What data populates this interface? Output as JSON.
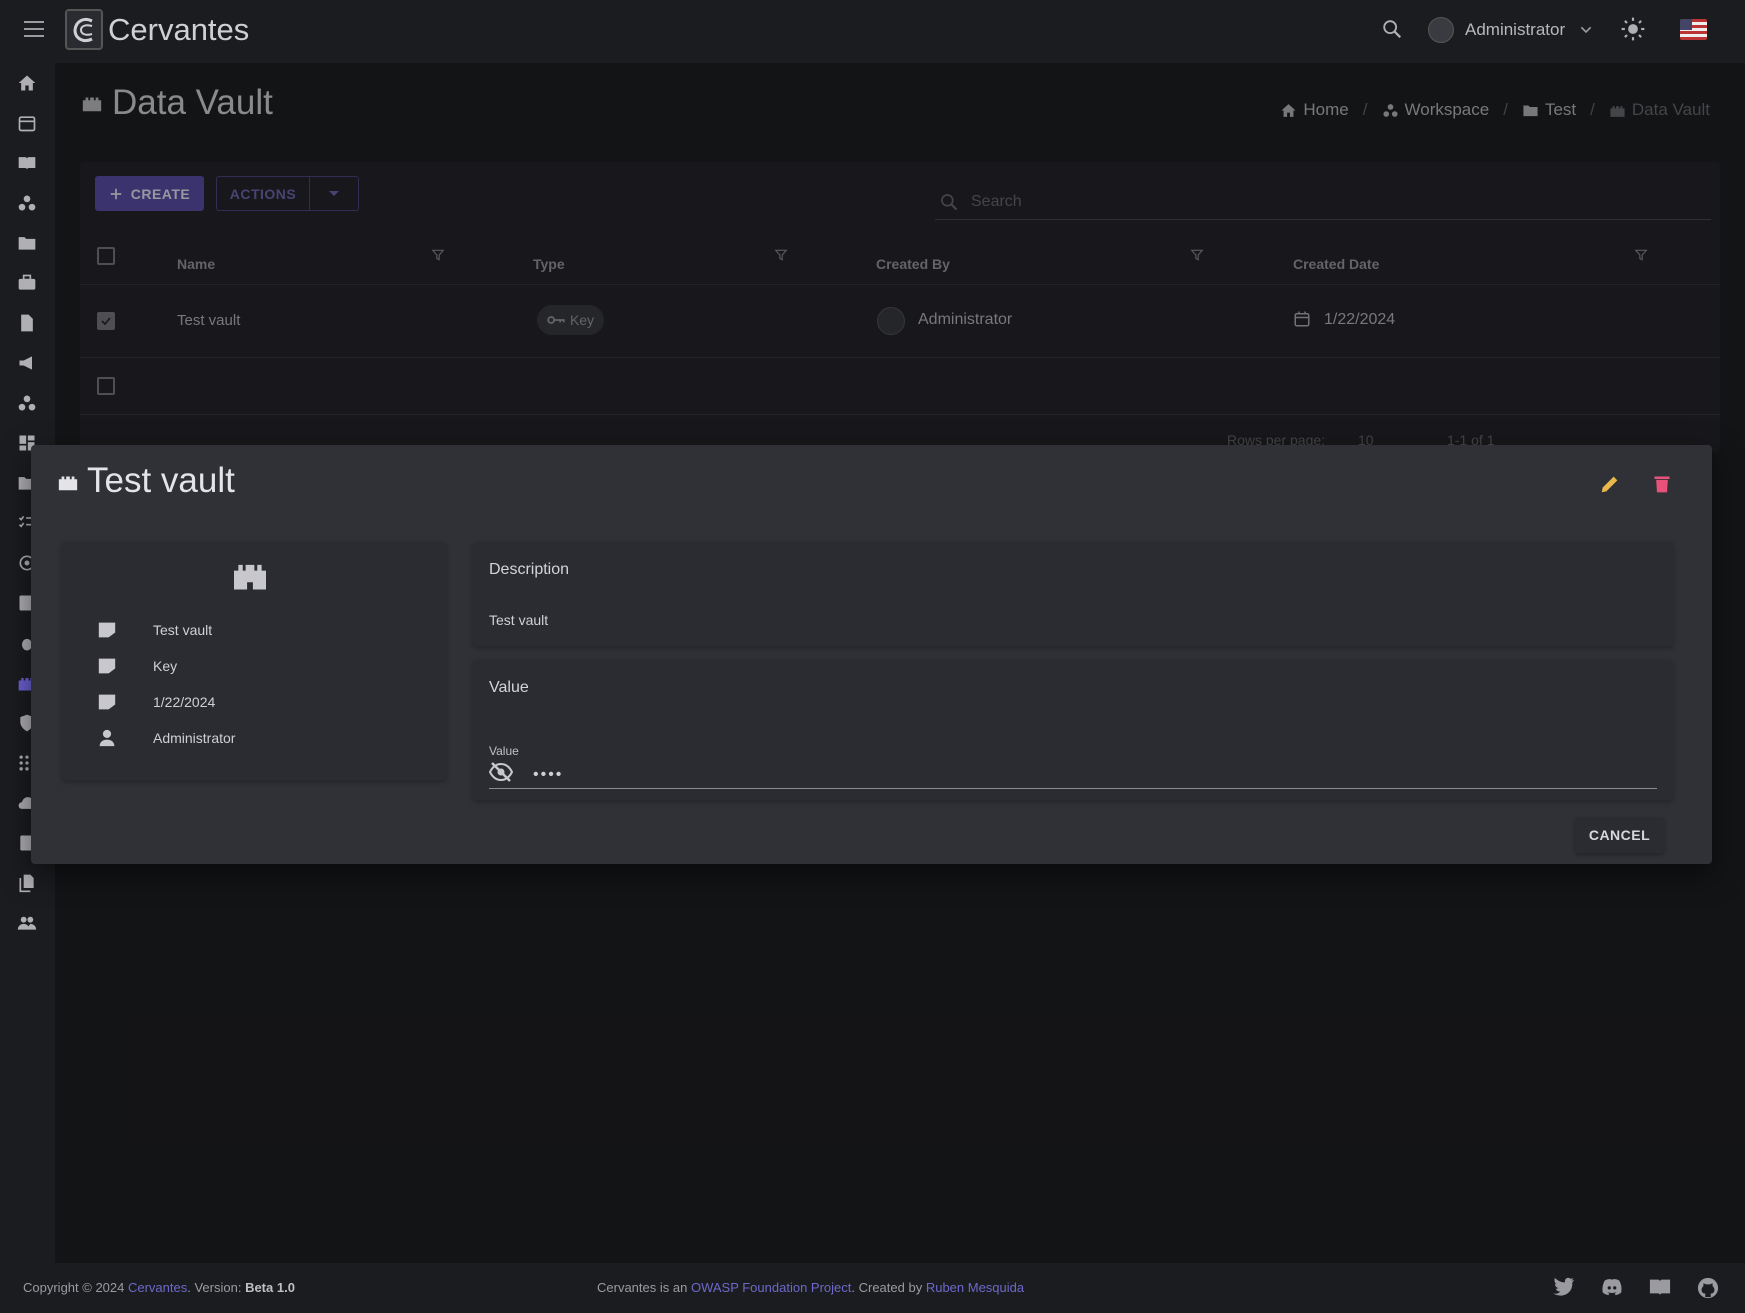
{
  "app": {
    "title": "Cervantes",
    "user": "Administrator"
  },
  "page": {
    "title": "Data Vault",
    "breadcrumb": [
      "Home",
      "Workspace",
      "Test",
      "Data Vault"
    ]
  },
  "toolbar": {
    "create_label": "CREATE",
    "actions_label": "ACTIONS",
    "search_placeholder": "Search"
  },
  "table": {
    "columns": [
      "Name",
      "Type",
      "Created By",
      "Created Date"
    ],
    "rows": [
      {
        "name": "Test vault",
        "type": "Key",
        "created_by": "Administrator",
        "created_date": "1/22/2024",
        "checked": true
      }
    ],
    "pager": {
      "rows_per_page_label": "Rows per page:",
      "rows_per_page": "10",
      "range": "1-1 of 1"
    }
  },
  "modal": {
    "title": "Test vault",
    "info": {
      "name": "Test vault",
      "type": "Key",
      "date": "1/22/2024",
      "user": "Administrator"
    },
    "description_title": "Description",
    "description": "Test vault",
    "value_title": "Value",
    "value_label": "Value",
    "value_masked": "••••",
    "cancel_label": "CANCEL"
  },
  "footer": {
    "copyright": "Copyright © 2024",
    "app_link": "Cervantes",
    "version_label": ". Version:",
    "version": "Beta 1.0",
    "project_prefix": "Cervantes is an",
    "project_link": "OWASP Foundation Project",
    "created_by_prefix": ". Created by",
    "author_link": "Ruben Mesquida"
  },
  "colors": {
    "accent": "#5a4fa8",
    "edit": "#e8b84a",
    "delete": "#e8527a"
  }
}
